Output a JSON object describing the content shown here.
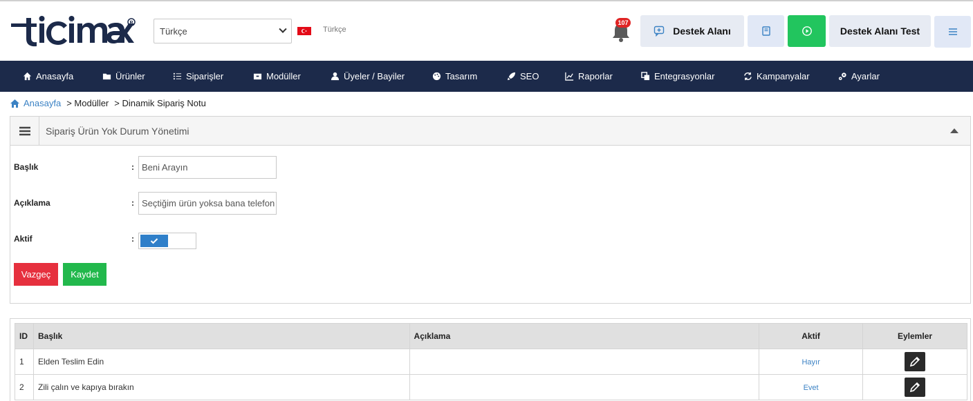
{
  "header": {
    "logo_text": "ticimax",
    "language_select": "Türkçe",
    "language_label": "Türkçe",
    "notification_count": "107",
    "support_button": "Destek Alanı",
    "test_button": "Destek Alanı Test"
  },
  "nav": {
    "items": [
      {
        "label": "Anasayfa",
        "icon": "home-icon"
      },
      {
        "label": "Ürünler",
        "icon": "folder-icon"
      },
      {
        "label": "Siparişler",
        "icon": "list-icon"
      },
      {
        "label": "Modüller",
        "icon": "box-icon"
      },
      {
        "label": "Üyeler / Bayiler",
        "icon": "users-icon"
      },
      {
        "label": "Tasarım",
        "icon": "palette-icon"
      },
      {
        "label": "SEO",
        "icon": "rocket-icon"
      },
      {
        "label": "Raporlar",
        "icon": "chart-icon"
      },
      {
        "label": "Entegrasyonlar",
        "icon": "copy-icon"
      },
      {
        "label": "Kampanyalar",
        "icon": "refresh-icon"
      },
      {
        "label": "Ayarlar",
        "icon": "gears-icon"
      }
    ]
  },
  "breadcrumb": {
    "home": "Anasayfa",
    "items": [
      "> Modüller",
      "> Dinamik Sipariş Notu"
    ]
  },
  "panel": {
    "title": "Sipariş Ürün Yok Durum Yönetimi",
    "fields": {
      "title_label": "Başlık",
      "title_value": "Beni Arayın",
      "desc_label": "Açıklama",
      "desc_value": "Seçtiğim ürün yoksa bana telefon",
      "active_label": "Aktif",
      "colon": ":",
      "active": true
    },
    "cancel_button": "Vazgeç",
    "save_button": "Kaydet"
  },
  "table": {
    "headers": [
      "ID",
      "Başlık",
      "Açıklama",
      "Aktif",
      "Eylemler"
    ],
    "rows": [
      {
        "id": "1",
        "title": "Elden Teslim Edin",
        "desc": "",
        "active": "Hayır"
      },
      {
        "id": "2",
        "title": "Zili çalın ve kapıya bırakın",
        "desc": "",
        "active": "Evet"
      }
    ]
  },
  "colors": {
    "navbar": "#1c2a4a",
    "accent_blue": "#2f7fc9",
    "cancel_red": "#e6303e",
    "save_green": "#22b84c"
  }
}
